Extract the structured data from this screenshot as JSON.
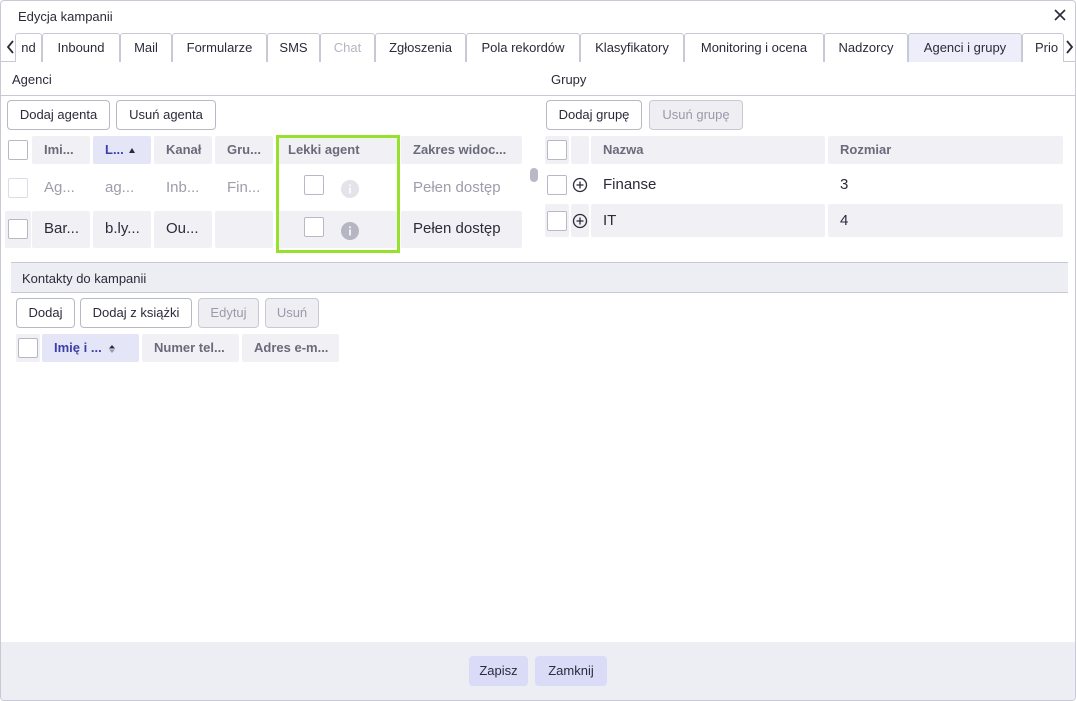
{
  "window": {
    "title": "Edycja kampanii"
  },
  "tabs": [
    {
      "label": "nd",
      "state": "normal"
    },
    {
      "label": "Inbound",
      "state": "normal"
    },
    {
      "label": "Mail",
      "state": "normal"
    },
    {
      "label": "Formularze",
      "state": "normal"
    },
    {
      "label": "SMS",
      "state": "normal"
    },
    {
      "label": "Chat",
      "state": "disabled"
    },
    {
      "label": "Zgłoszenia",
      "state": "normal"
    },
    {
      "label": "Pola rekordów",
      "state": "normal"
    },
    {
      "label": "Klasyfikatory",
      "state": "normal"
    },
    {
      "label": "Monitoring i ocena",
      "state": "normal"
    },
    {
      "label": "Nadzorcy",
      "state": "normal"
    },
    {
      "label": "Agenci i grupy",
      "state": "active"
    },
    {
      "label": "Prio",
      "state": "normal"
    }
  ],
  "agents": {
    "section_label": "Agenci",
    "add_button": "Dodaj agenta",
    "remove_button": "Usuń agenta",
    "columns": [
      "Imi...",
      "L...",
      "Kanał",
      "Gru...",
      "Lekki agent",
      "Zakres widoc..."
    ],
    "rows": [
      {
        "first": "Ag...",
        "login": "ag...",
        "channel": "Inb...",
        "group": "Fin...",
        "scope": "Pełen dostęp",
        "faded": true
      },
      {
        "first": "Bar...",
        "login": "b.ly...",
        "channel": "Ou...",
        "group": "",
        "scope": "Pełen dostęp",
        "faded": false
      }
    ]
  },
  "groups": {
    "section_label": "Grupy",
    "add_button": "Dodaj grupę",
    "remove_button": "Usuń grupę",
    "columns": [
      "Nazwa",
      "Rozmiar"
    ],
    "rows": [
      {
        "name": "Finanse",
        "size": "3"
      },
      {
        "name": "IT",
        "size": "4"
      }
    ]
  },
  "contacts": {
    "section_label": "Kontakty do kampanii",
    "buttons": {
      "add": "Dodaj",
      "add_from_book": "Dodaj z książki",
      "edit": "Edytuj",
      "remove": "Usuń"
    },
    "columns": [
      "Imię i ...",
      "Numer tel...",
      "Adres e-m..."
    ]
  },
  "footer": {
    "save": "Zapisz",
    "close": "Zamknij"
  },
  "colors": {
    "accent": "#d9dbf7",
    "highlight": "#97e02c",
    "header_bg": "#f1f1f5",
    "panel_bg": "#eceef4"
  },
  "icons": {
    "close": "close-icon",
    "prev": "chevron-left-icon",
    "next": "chevron-right-icon",
    "info": "info-icon",
    "expand": "plus-circle-icon",
    "sort": "sort-asc-icon"
  }
}
